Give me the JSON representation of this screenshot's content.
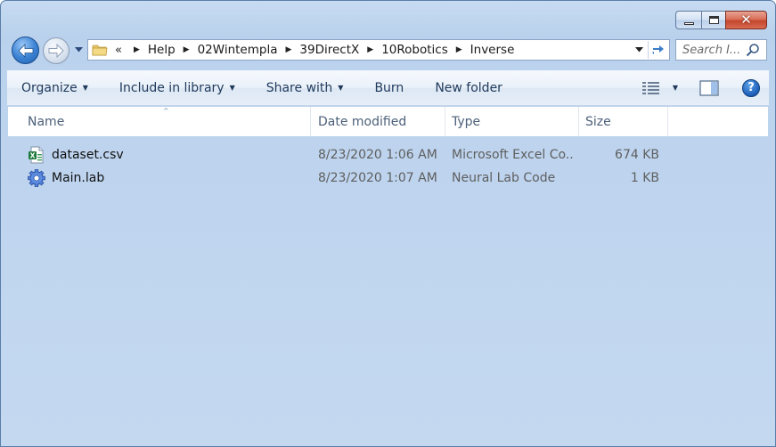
{
  "window": {
    "caption_buttons": {
      "minimize_icon": "minimize-icon",
      "maximize_icon": "maximize-icon",
      "close_icon": "close-icon",
      "close_glyph": "✕"
    }
  },
  "nav": {
    "back_icon": "back-arrow-icon",
    "forward_icon": "forward-arrow-icon",
    "history_icon": "chevron-down-icon",
    "breadcrumb_overflow": "«",
    "breadcrumb": [
      "Help",
      "02Wintempla",
      "39DirectX",
      "10Robotics",
      "Inverse"
    ],
    "refresh_icon": "refresh-icon",
    "search_placeholder": "Search I...",
    "search_icon": "search-icon"
  },
  "toolbar": {
    "organize": "Organize",
    "include_in_library": "Include in library",
    "share_with": "Share with",
    "burn": "Burn",
    "new_folder": "New folder",
    "views_icon": "view-details-icon",
    "preview_pane_icon": "preview-pane-icon",
    "help_icon": "help-icon",
    "help_glyph": "?"
  },
  "columns": {
    "name": "Name",
    "date_modified": "Date modified",
    "type": "Type",
    "size": "Size",
    "sort_glyph": "^"
  },
  "files": [
    {
      "name": "dataset.csv",
      "date": "8/23/2020 1:06 AM",
      "type": "Microsoft Excel Co...",
      "size": "674 KB",
      "icon": "excel-file-icon"
    },
    {
      "name": "Main.lab",
      "date": "8/23/2020 1:07 AM",
      "type": "Neural Lab Code",
      "size": "1 KB",
      "icon": "gear-file-icon"
    }
  ],
  "colors": {
    "frame": "#bcd3ee",
    "toolbar_text": "#1e395b",
    "header_text": "#4c607a",
    "close_button": "#c3462c"
  }
}
